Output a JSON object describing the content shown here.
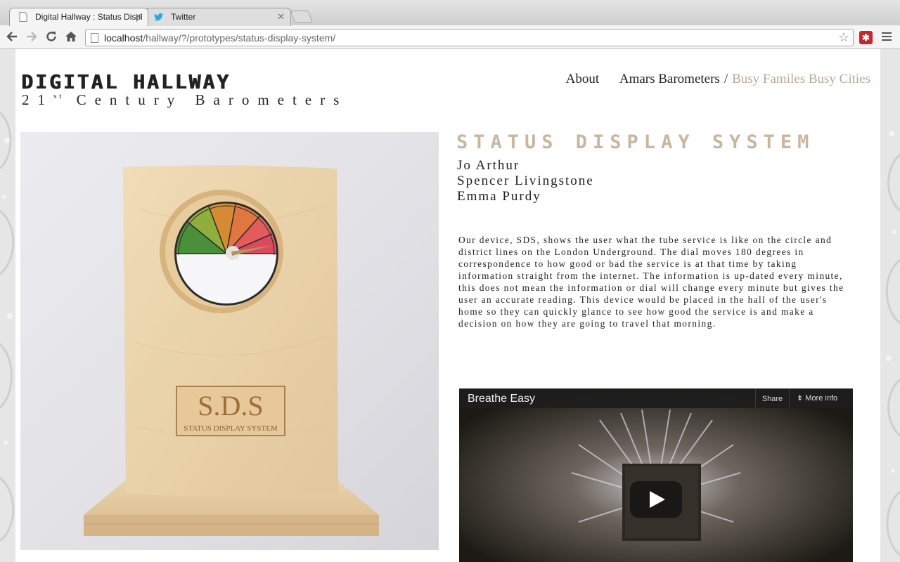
{
  "browser": {
    "tabs": [
      {
        "title": "Digital Hallway : Status Displ",
        "active": true
      },
      {
        "title": "Twitter",
        "active": false
      }
    ],
    "url_host": "localhost",
    "url_path": "/hallway/?/prototypes/status-display-system/"
  },
  "site": {
    "logo_title": "DIGITAL HALLWAY",
    "logo_sub_pre": "21",
    "logo_sub_sup": "st",
    "logo_sub_post": " Century Barometers"
  },
  "nav": {
    "about": "About",
    "amars": "Amars Barometers",
    "separator": "/",
    "busy": "Busy Familes Busy Cities",
    "active_color": "#b8a996"
  },
  "project": {
    "heading": "STATUS DISPLAY SYSTEM",
    "authors": [
      "Jo Arthur",
      "Spencer Livingstone",
      "Emma Purdy"
    ],
    "description": "Our device, SDS, shows the user what the tube service is like on the circle and district lines on the London Underground. The dial moves 180 degrees in correspondence to how good or bad the service is at that time by taking information straight from the internet. The information is up-dated every minute, this does not mean the information or dial will change every minute but gives the user an accurate reading. This device would be placed in the hall of the user's home so they can quickly glance to see how good the service is and make a decision on how they are going to travel that morning."
  },
  "photo": {
    "plate_big": "S.D.S",
    "plate_small": "STATUS DISPLAY SYSTEM"
  },
  "video": {
    "title": "Breathe Easy",
    "share": "Share",
    "more_info": "More info"
  }
}
